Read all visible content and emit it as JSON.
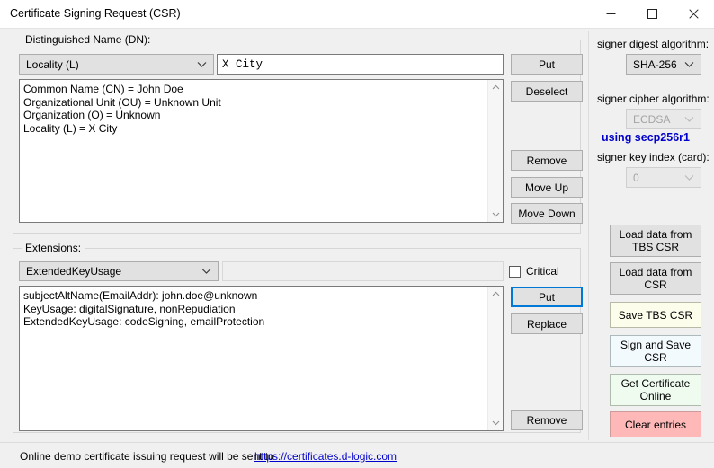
{
  "window": {
    "title": "Certificate Signing Request (CSR)",
    "controls": {
      "minimize": "minimize-icon",
      "maximize": "maximize-icon",
      "close": "close-icon"
    }
  },
  "dn_group": {
    "label": "Distinguished Name (DN):",
    "type_combo": {
      "value": "Locality (L)",
      "icon": "chevron-down-icon"
    },
    "value_field": {
      "value": "X City",
      "placeholder": ""
    },
    "list_items": [
      "Common Name (CN) = John Doe",
      "Organizational Unit (OU) = Unknown Unit",
      "Organization (O) = Unknown",
      "Locality (L) = X City"
    ],
    "buttons": {
      "put": "Put",
      "deselect": "Deselect",
      "remove": "Remove",
      "move_up": "Move Up",
      "move_down": "Move Down"
    }
  },
  "ext_group": {
    "label": "Extensions:",
    "type_combo": {
      "value": "ExtendedKeyUsage",
      "icon": "chevron-down-icon"
    },
    "value_field": {
      "value": "",
      "placeholder": ""
    },
    "critical_checkbox": {
      "label": "Critical",
      "checked": false
    },
    "list_items": [
      "subjectAltName(EmailAddr): john.doe@unknown",
      "KeyUsage: digitalSignature, nonRepudiation",
      "ExtendedKeyUsage: codeSigning, emailProtection"
    ],
    "buttons": {
      "put": "Put",
      "replace": "Replace",
      "remove": "Remove"
    }
  },
  "signer_panel": {
    "digest_label": "signer digest algorithm:",
    "digest_value": "SHA-256",
    "cipher_label": "signer cipher algorithm:",
    "cipher_value": "ECDSA",
    "curve_text": "using secp256r1",
    "key_index_label": "signer key index (card):",
    "key_index_value": "0",
    "actions": [
      {
        "label": "Load data from\nTBS CSR",
        "name": "load-data-from-tbs-csr-button",
        "style": "plain"
      },
      {
        "label": "Load data from\nCSR",
        "name": "load-data-from-csr-button",
        "style": "plain"
      },
      {
        "label": "Save TBS CSR",
        "name": "save-tbs-csr-button",
        "style": "cream"
      },
      {
        "label": "Sign and Save\nCSR",
        "name": "sign-and-save-csr-button",
        "style": "blueish"
      },
      {
        "label": "Get Certificate\nOnline",
        "name": "get-certificate-online-button",
        "style": "greenish"
      },
      {
        "label": "Clear entries",
        "name": "clear-entries-button",
        "style": "pink"
      }
    ]
  },
  "statusbar": {
    "text": "Online demo certificate issuing request will be sent to",
    "link": "https://certificates.d-logic.com"
  },
  "colors": {
    "accent_focus": "#0078d7",
    "link": "#0000cc",
    "curve_text": "#0000cc",
    "danger_button": "#ffb8b8",
    "window_background": "#f0f0f0"
  }
}
